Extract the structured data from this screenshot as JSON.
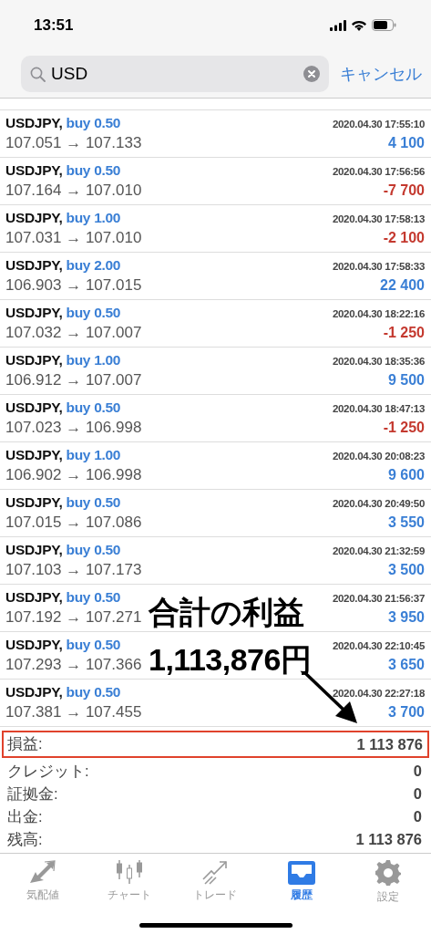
{
  "status_bar": {
    "time": "13:51"
  },
  "search": {
    "value": "USD",
    "cancel": "キャンセル"
  },
  "trades": [
    {
      "symbol": "USDJPY,",
      "side": "buy 0.50",
      "time": "2020.04.30 17:55:10",
      "prices": "107.051 → 107.133",
      "profit": "4 100",
      "kind": "gain"
    },
    {
      "symbol": "USDJPY,",
      "side": "buy 0.50",
      "time": "2020.04.30 17:56:56",
      "prices": "107.164 → 107.010",
      "profit": "-7 700",
      "kind": "loss"
    },
    {
      "symbol": "USDJPY,",
      "side": "buy 1.00",
      "time": "2020.04.30 17:58:13",
      "prices": "107.031 → 107.010",
      "profit": "-2 100",
      "kind": "loss"
    },
    {
      "symbol": "USDJPY,",
      "side": "buy 2.00",
      "time": "2020.04.30 17:58:33",
      "prices": "106.903 → 107.015",
      "profit": "22 400",
      "kind": "gain"
    },
    {
      "symbol": "USDJPY,",
      "side": "buy 0.50",
      "time": "2020.04.30 18:22:16",
      "prices": "107.032 → 107.007",
      "profit": "-1 250",
      "kind": "loss"
    },
    {
      "symbol": "USDJPY,",
      "side": "buy 1.00",
      "time": "2020.04.30 18:35:36",
      "prices": "106.912 → 107.007",
      "profit": "9 500",
      "kind": "gain"
    },
    {
      "symbol": "USDJPY,",
      "side": "buy 0.50",
      "time": "2020.04.30 18:47:13",
      "prices": "107.023 → 106.998",
      "profit": "-1 250",
      "kind": "loss"
    },
    {
      "symbol": "USDJPY,",
      "side": "buy 1.00",
      "time": "2020.04.30 20:08:23",
      "prices": "106.902 → 106.998",
      "profit": "9 600",
      "kind": "gain"
    },
    {
      "symbol": "USDJPY,",
      "side": "buy 0.50",
      "time": "2020.04.30 20:49:50",
      "prices": "107.015 → 107.086",
      "profit": "3 550",
      "kind": "gain"
    },
    {
      "symbol": "USDJPY,",
      "side": "buy 0.50",
      "time": "2020.04.30 21:32:59",
      "prices": "107.103 → 107.173",
      "profit": "3 500",
      "kind": "gain"
    },
    {
      "symbol": "USDJPY,",
      "side": "buy 0.50",
      "time": "2020.04.30 21:56:37",
      "prices": "107.192 → 107.271",
      "profit": "3 950",
      "kind": "gain"
    },
    {
      "symbol": "USDJPY,",
      "side": "buy 0.50",
      "time": "2020.04.30 22:10:45",
      "prices": "107.293 → 107.366",
      "profit": "3 650",
      "kind": "gain"
    },
    {
      "symbol": "USDJPY,",
      "side": "buy 0.50",
      "time": "2020.04.30 22:27:18",
      "prices": "107.381 → 107.455",
      "profit": "3 700",
      "kind": "gain"
    }
  ],
  "annotation": {
    "title": "合計の利益",
    "amount": "1,113,876円"
  },
  "summary": [
    {
      "label": "損益:",
      "value": "1 113 876",
      "highlighted": true
    },
    {
      "label": "クレジット:",
      "value": "0",
      "highlighted": false
    },
    {
      "label": "証拠金:",
      "value": "0",
      "highlighted": false
    },
    {
      "label": "出金:",
      "value": "0",
      "highlighted": false
    },
    {
      "label": "残高:",
      "value": "1 113 876",
      "highlighted": false
    }
  ],
  "tabs": [
    {
      "label": "気配値",
      "kind": "quotes",
      "selected": false
    },
    {
      "label": "チャート",
      "kind": "chart",
      "selected": false
    },
    {
      "label": "トレード",
      "kind": "trade",
      "selected": false
    },
    {
      "label": "履歴",
      "kind": "history",
      "selected": true
    },
    {
      "label": "設定",
      "kind": "settings",
      "selected": false
    }
  ]
}
